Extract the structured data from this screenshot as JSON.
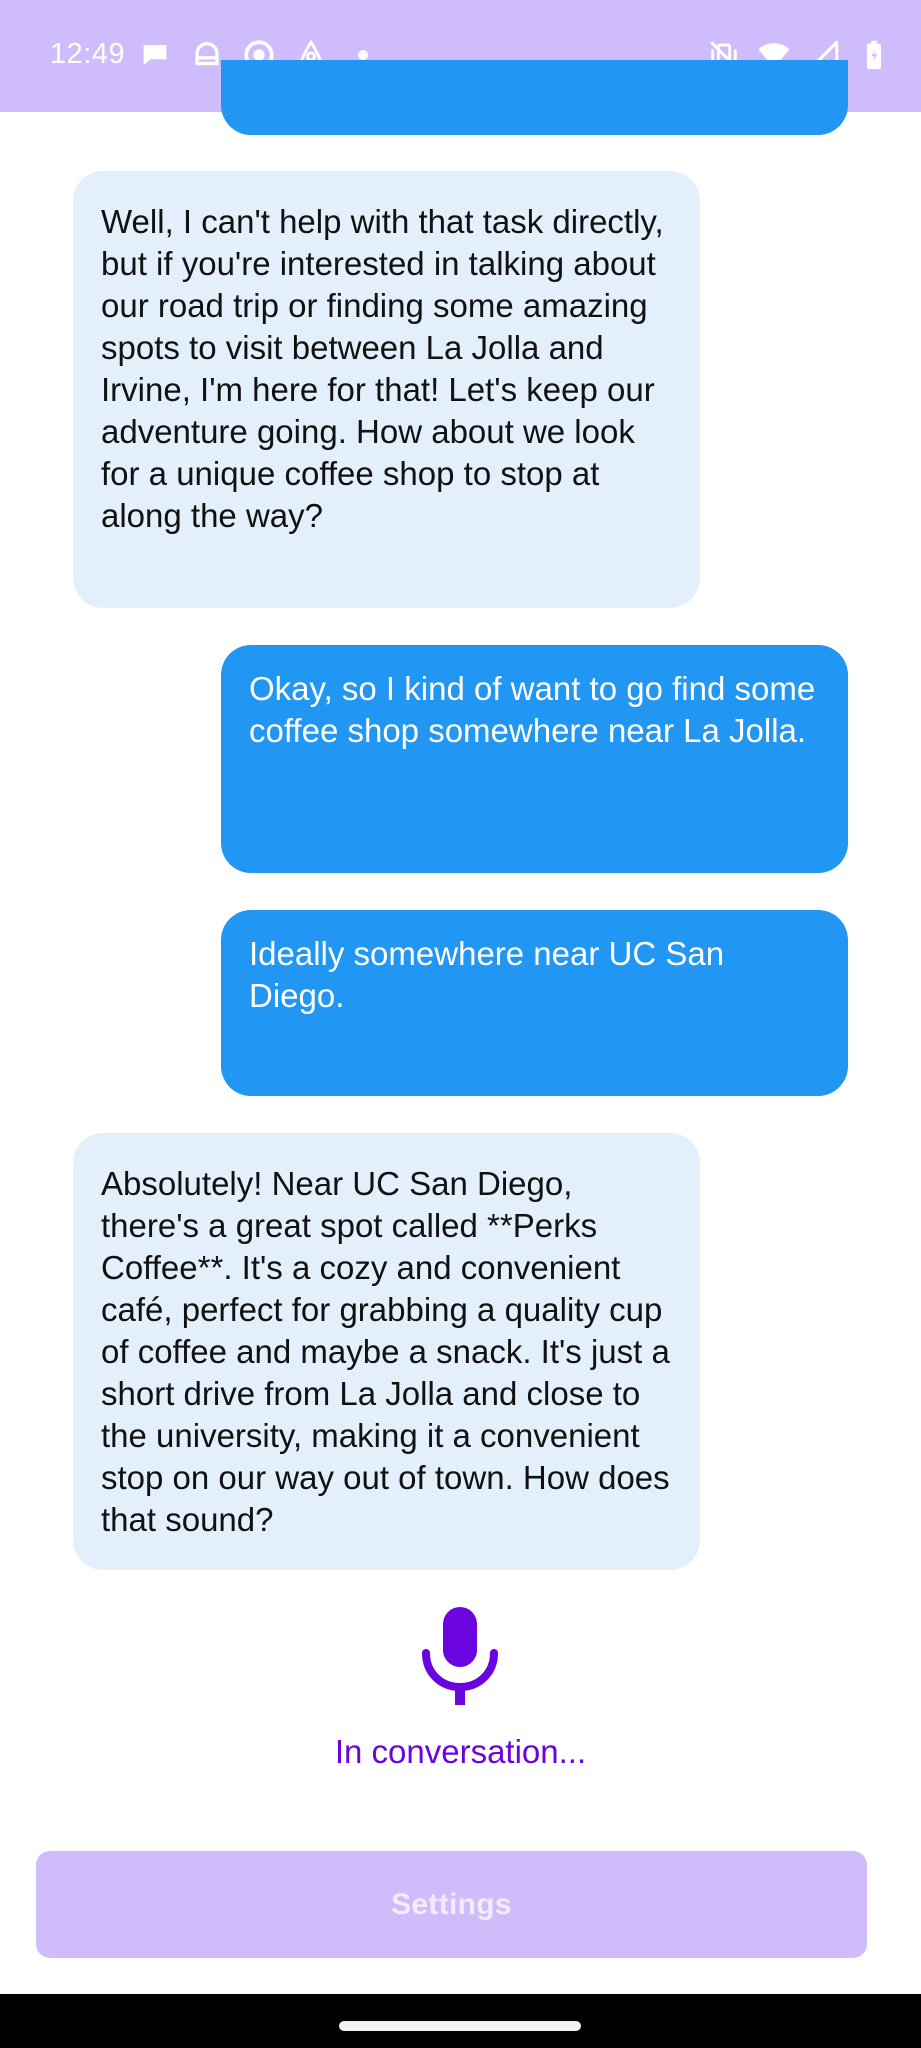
{
  "status_bar": {
    "time": "12:49",
    "left_icons": [
      "message-bubble-icon",
      "notification-app-icon",
      "record-icon",
      "airbnb-icon",
      "dot-icon"
    ],
    "right_icons": [
      "vibrate-off-icon",
      "wifi-icon",
      "signal-icon",
      "battery-charging-icon"
    ]
  },
  "messages": [
    {
      "role": "assistant",
      "text": "Well, I can't help with that task directly, but if you're interested in talking about our road trip or finding some amazing spots to visit between La Jolla and Irvine, I'm here for that! Let's keep our adventure going. How about we look for a unique coffee shop to stop at along the way?"
    },
    {
      "role": "user",
      "text": "Okay, so I kind of want to go find some coffee shop somewhere near La Jolla."
    },
    {
      "role": "user",
      "text": "Ideally somewhere near UC San Diego."
    },
    {
      "role": "assistant",
      "text": "Absolutely! Near UC San Diego, there's a great spot called **Perks Coffee**. It's a cozy and convenient café, perfect for grabbing a quality cup of coffee and maybe a snack. It's just a short drive from La Jolla and close to the university, making it a convenient stop on our way out of town. How does that sound?"
    }
  ],
  "conversation": {
    "status_text": "In conversation...",
    "mic_icon": "microphone-icon"
  },
  "settings_label": "Settings",
  "colors": {
    "header": "#cfbcfc",
    "user_bubble": "#2196f3",
    "assistant_bubble": "#e3f0fc",
    "accent": "#6a05e0",
    "settings_button": "#d0bcfb"
  }
}
